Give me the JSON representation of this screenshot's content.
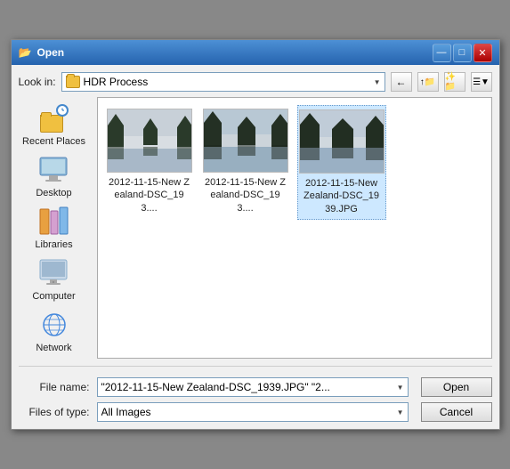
{
  "dialog": {
    "title": "Open",
    "icon": "📂"
  },
  "titlebar": {
    "minimize_label": "—",
    "maximize_label": "□",
    "close_label": "✕"
  },
  "toolbar": {
    "look_in_label": "Look in:",
    "folder_name": "HDR Process",
    "back_btn": "←",
    "up_btn": "↑",
    "new_folder_btn": "📁",
    "view_btn": "☰"
  },
  "sidebar": {
    "items": [
      {
        "id": "recent-places",
        "label": "Recent Places",
        "icon": "recent"
      },
      {
        "id": "desktop",
        "label": "Desktop",
        "icon": "desktop"
      },
      {
        "id": "libraries",
        "label": "Libraries",
        "icon": "libraries"
      },
      {
        "id": "computer",
        "label": "Computer",
        "icon": "computer"
      },
      {
        "id": "network",
        "label": "Network",
        "icon": "network"
      }
    ]
  },
  "files": [
    {
      "id": "file1",
      "name": "2012-11-15-New Zealand-DSC_193....",
      "selected": false
    },
    {
      "id": "file2",
      "name": "2012-11-15-New Zealand-DSC_193....",
      "selected": false
    },
    {
      "id": "file3",
      "name": "2012-11-15-New Zealand-DSC_1939.JPG",
      "selected": true
    }
  ],
  "bottom": {
    "file_name_label": "File name:",
    "file_name_value": "\"2012-11-15-New Zealand-DSC_1939.JPG\" \"2...",
    "files_of_type_label": "Files of type:",
    "files_of_type_value": "All Images",
    "open_label": "Open",
    "cancel_label": "Cancel"
  }
}
